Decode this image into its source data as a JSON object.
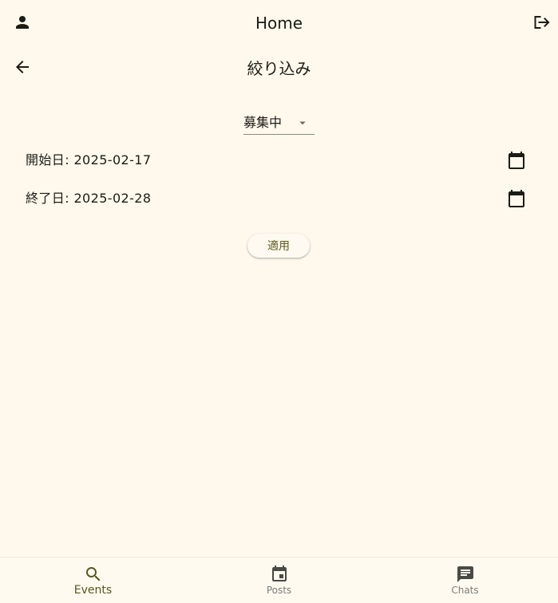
{
  "appbar": {
    "title": "Home",
    "left_icon": "person-icon",
    "right_icon": "logout-icon"
  },
  "filter": {
    "title": "絞り込み",
    "back_icon": "arrow-back-icon",
    "status_select": {
      "value": "募集中"
    },
    "start_date_label": "開始日: 2025-02-17",
    "end_date_label": "終了日: 2025-02-28",
    "calendar_icon": "calendar-icon",
    "apply_label": "適用"
  },
  "bottom_nav": {
    "items": [
      {
        "label": "Events",
        "icon": "search-icon",
        "active": true
      },
      {
        "label": "Posts",
        "icon": "event-icon",
        "active": false
      },
      {
        "label": "Chats",
        "icon": "chat-icon",
        "active": false
      }
    ]
  },
  "colors": {
    "background": "#fef9ec",
    "accent": "#55581c",
    "text": "#1d1b16"
  }
}
